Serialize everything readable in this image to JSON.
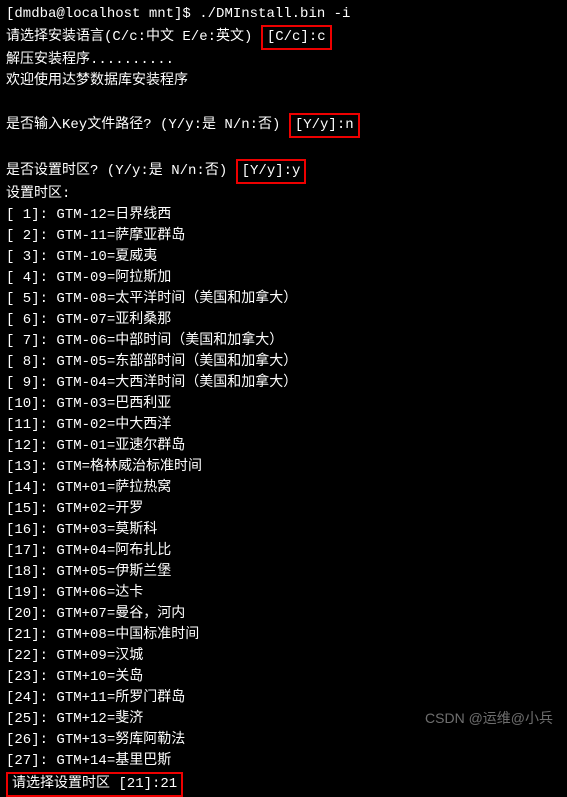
{
  "prompt_line": {
    "user_host": "[dmdba@localhost mnt]$ ",
    "command": "./DMInstall.bin -i"
  },
  "lang_select": {
    "text": "请选择安装语言(C/c:中文 E/e:英文) ",
    "boxed": "[C/c]:c"
  },
  "extract_line": "解压安装程序..........",
  "welcome_line": "欢迎使用达梦数据库安装程序",
  "key_prompt": {
    "text": "是否输入Key文件路径? (Y/y:是 N/n:否) ",
    "boxed": "[Y/y]:n"
  },
  "tz_prompt": {
    "text": "是否设置时区? (Y/y:是 N/n:否) ",
    "boxed": "[Y/y]:y"
  },
  "tz_header": "设置时区:",
  "timezones": [
    {
      "idx": "[ 1]: ",
      "label": "GTM-12=日界线西"
    },
    {
      "idx": "[ 2]: ",
      "label": "GTM-11=萨摩亚群岛"
    },
    {
      "idx": "[ 3]: ",
      "label": "GTM-10=夏威夷"
    },
    {
      "idx": "[ 4]: ",
      "label": "GTM-09=阿拉斯加"
    },
    {
      "idx": "[ 5]: ",
      "label": "GTM-08=太平洋时间（美国和加拿大）"
    },
    {
      "idx": "[ 6]: ",
      "label": "GTM-07=亚利桑那"
    },
    {
      "idx": "[ 7]: ",
      "label": "GTM-06=中部时间（美国和加拿大）"
    },
    {
      "idx": "[ 8]: ",
      "label": "GTM-05=东部部时间（美国和加拿大）"
    },
    {
      "idx": "[ 9]: ",
      "label": "GTM-04=大西洋时间（美国和加拿大）"
    },
    {
      "idx": "[10]: ",
      "label": "GTM-03=巴西利亚"
    },
    {
      "idx": "[11]: ",
      "label": "GTM-02=中大西洋"
    },
    {
      "idx": "[12]: ",
      "label": "GTM-01=亚速尔群岛"
    },
    {
      "idx": "[13]: ",
      "label": "GTM=格林威治标准时间"
    },
    {
      "idx": "[14]: ",
      "label": "GTM+01=萨拉热窝"
    },
    {
      "idx": "[15]: ",
      "label": "GTM+02=开罗"
    },
    {
      "idx": "[16]: ",
      "label": "GTM+03=莫斯科"
    },
    {
      "idx": "[17]: ",
      "label": "GTM+04=阿布扎比"
    },
    {
      "idx": "[18]: ",
      "label": "GTM+05=伊斯兰堡"
    },
    {
      "idx": "[19]: ",
      "label": "GTM+06=达卡"
    },
    {
      "idx": "[20]: ",
      "label": "GTM+07=曼谷，河内"
    },
    {
      "idx": "[21]: ",
      "label": "GTM+08=中国标准时间"
    },
    {
      "idx": "[22]: ",
      "label": "GTM+09=汉城"
    },
    {
      "idx": "[23]: ",
      "label": "GTM+10=关岛"
    },
    {
      "idx": "[24]: ",
      "label": "GTM+11=所罗门群岛"
    },
    {
      "idx": "[25]: ",
      "label": "GTM+12=斐济"
    },
    {
      "idx": "[26]: ",
      "label": "GTM+13=努库阿勒法"
    },
    {
      "idx": "[27]: ",
      "label": "GTM+14=基里巴斯"
    }
  ],
  "final_prompt": {
    "boxed": "请选择设置时区 [21]:21"
  },
  "watermark": "CSDN @运维@小兵"
}
